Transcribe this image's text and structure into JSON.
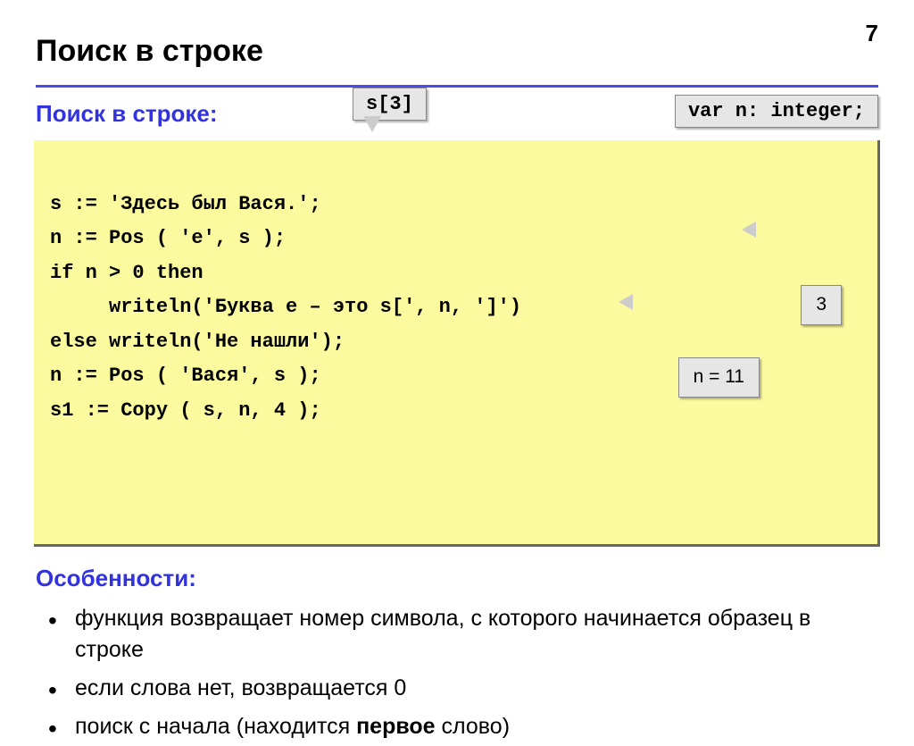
{
  "page_number": "7",
  "title": "Поиск в строке",
  "subheading": "Поиск в строке:",
  "callout_s3": "s[3]",
  "callout_var": "var n: integer;",
  "code_lines": {
    "l1": "s := 'Здесь был Вася.';",
    "l2": "n := Pos ( 'е', s );",
    "l3": "if n > 0 then",
    "l4": "     writeln('Буква е – это s[', n, ']')",
    "l5": "else writeln('Не нашли');",
    "l6": "n := Pos ( 'Вася', s );",
    "l7": "s1 := Copy ( s, n, 4 );"
  },
  "callout_3": "3",
  "callout_n11": "n = 11",
  "features_title": "Особенности:",
  "features": {
    "f1": "функция возвращает номер символа, с которого начинается образец в строке",
    "f2": "если слова нет, возвращается 0",
    "f3_pre": "поиск с начала (находится ",
    "f3_bold": "первое",
    "f3_post": " слово)"
  }
}
